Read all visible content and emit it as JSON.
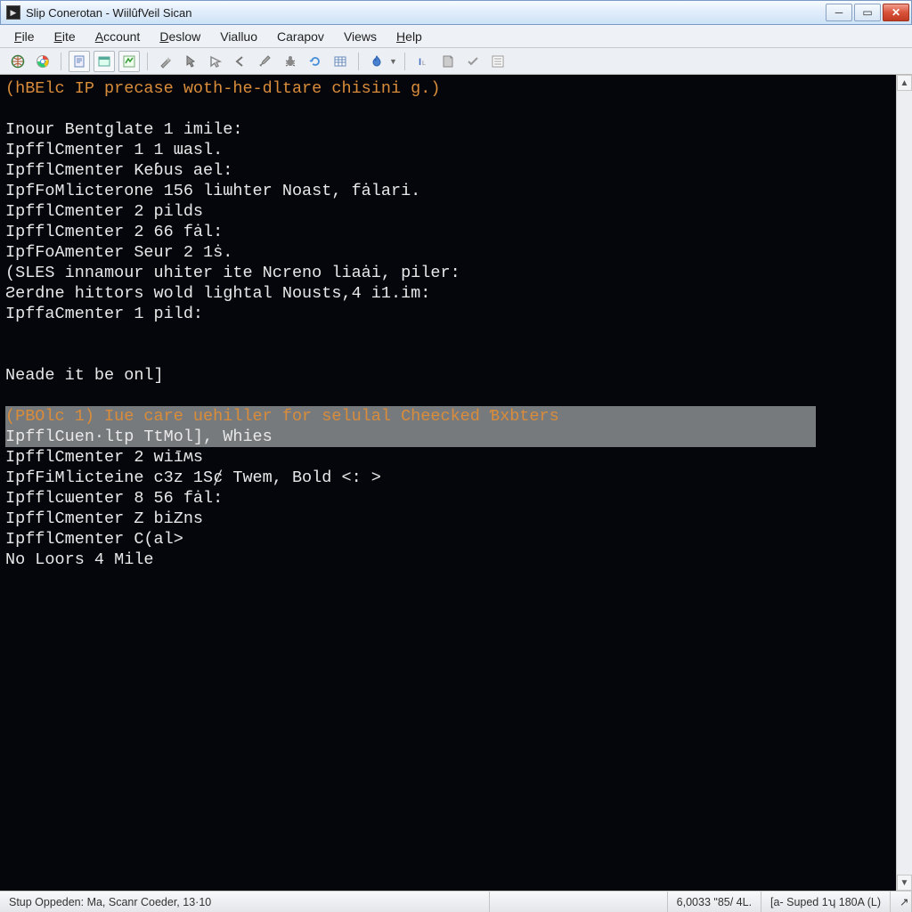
{
  "window": {
    "title": "Slip Conerotan - WiilûfVeil Sican"
  },
  "menus": {
    "file": "File",
    "eite": "Eite",
    "account": "Account",
    "deslow": "Deslow",
    "vialluo": "Vialluo",
    "carapov": "Carapov",
    "views": "Views",
    "help": "Help"
  },
  "toolbar_icons": {
    "globe": "globe-icon",
    "chrome": "browser-icon",
    "doc": "document-icon",
    "window": "window-icon",
    "symbol": "symbol-icon",
    "wand": "wand-icon",
    "pointer": "pointer-icon",
    "cursor": "cursor-icon",
    "back": "arrow-left-icon",
    "pen": "pen-icon",
    "bug": "bug-icon",
    "refresh": "refresh-icon",
    "table": "table-icon",
    "flame": "flame-icon",
    "dropdown": "dropdown-icon",
    "letter": "identifier-icon",
    "note": "note-icon",
    "check": "check-icon",
    "list": "list-icon"
  },
  "console": {
    "header": "(hBElc IP precase woth-he-dltare chisini g.)",
    "lines": [
      "Inour Bentɡlate 1 imile:",
      "IpfflCmenter 1 1 ɯasl.",
      "IpfflCmenter Keɓus ael:",
      "IpfFoMlicterone 156 liɯhter Noast, fȧlari.",
      "IpfflCmenter 2 pilds",
      "IpfflCmenter 2 66 fȧl:",
      "IpfFoAmenter Seur 2 1ṡ.",
      "(SLES innamour uhiter ite Ncreno liaȧi, piler:",
      "Ƨerdne hittors wold lightal Nousts,4 i1.im:",
      "IpffaCmenter 1 pild:"
    ],
    "break_line": "Neade it be onl]",
    "highlight_header": "(PBOlc 1) Iue care uehiller for selulal Cheecked Ɓxbters",
    "highlight_sub": "IpfflCuen·ltp TtMol], Whies",
    "lines2": [
      "IpfflCmenter 2 wiīʍs",
      "IpfFiMlicteine c3ᴢ 1Sȼ Twem, Bold <: >",
      "Ipfflcɯenter 8 56 fȧl:",
      "IpfflCmenter Z biZns",
      "IpfflCmenter C(al>",
      "No Loors 4 Mile"
    ]
  },
  "status": {
    "left": "Stup Oppeden: Ma, Scanr Coeder, 13·10",
    "mid": "6,0033 ʺ85/ 4L.",
    "right": "[a- Suped 1ʮ  180A (L)",
    "corner": "↗"
  },
  "colors": {
    "console_bg": "#04060c",
    "accent_orange": "#d98c3a",
    "text": "#e8e8e8",
    "highlight_bg": "#777a7d"
  }
}
